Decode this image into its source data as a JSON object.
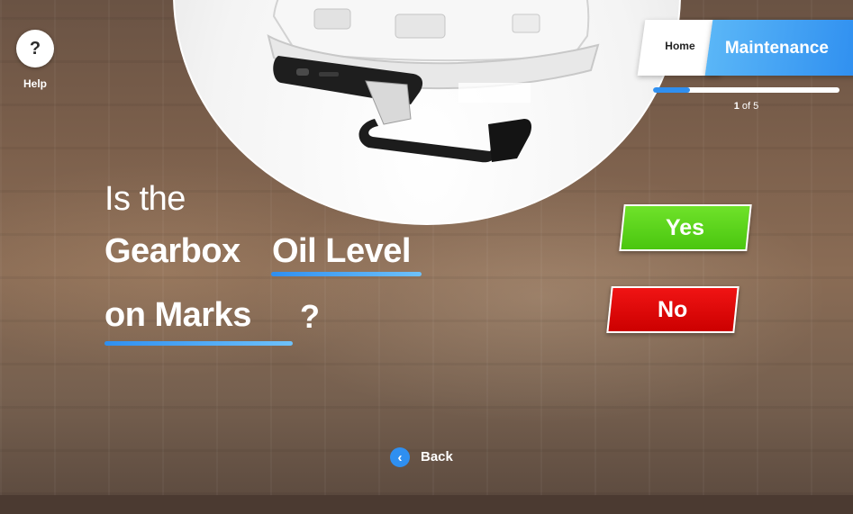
{
  "help": {
    "icon": "question-icon",
    "glyph": "?",
    "label": "Help"
  },
  "nav": {
    "home_label": "Home",
    "section_label": "Maintenance"
  },
  "progress": {
    "current": "1",
    "of_text": "of 5",
    "total": 5,
    "fraction": 0.2
  },
  "question": {
    "prefix": "Is the",
    "part1": "Gearbox",
    "part2": "Oil Level",
    "part3": "on Marks",
    "suffix": "?"
  },
  "answers": {
    "yes_label": "Yes",
    "no_label": "No"
  },
  "back": {
    "label": "Back",
    "icon": "chevron-left-icon",
    "glyph": "‹"
  },
  "colors": {
    "accent": "#2f8ff0",
    "yes": "#4ac60f",
    "no": "#d40000"
  }
}
